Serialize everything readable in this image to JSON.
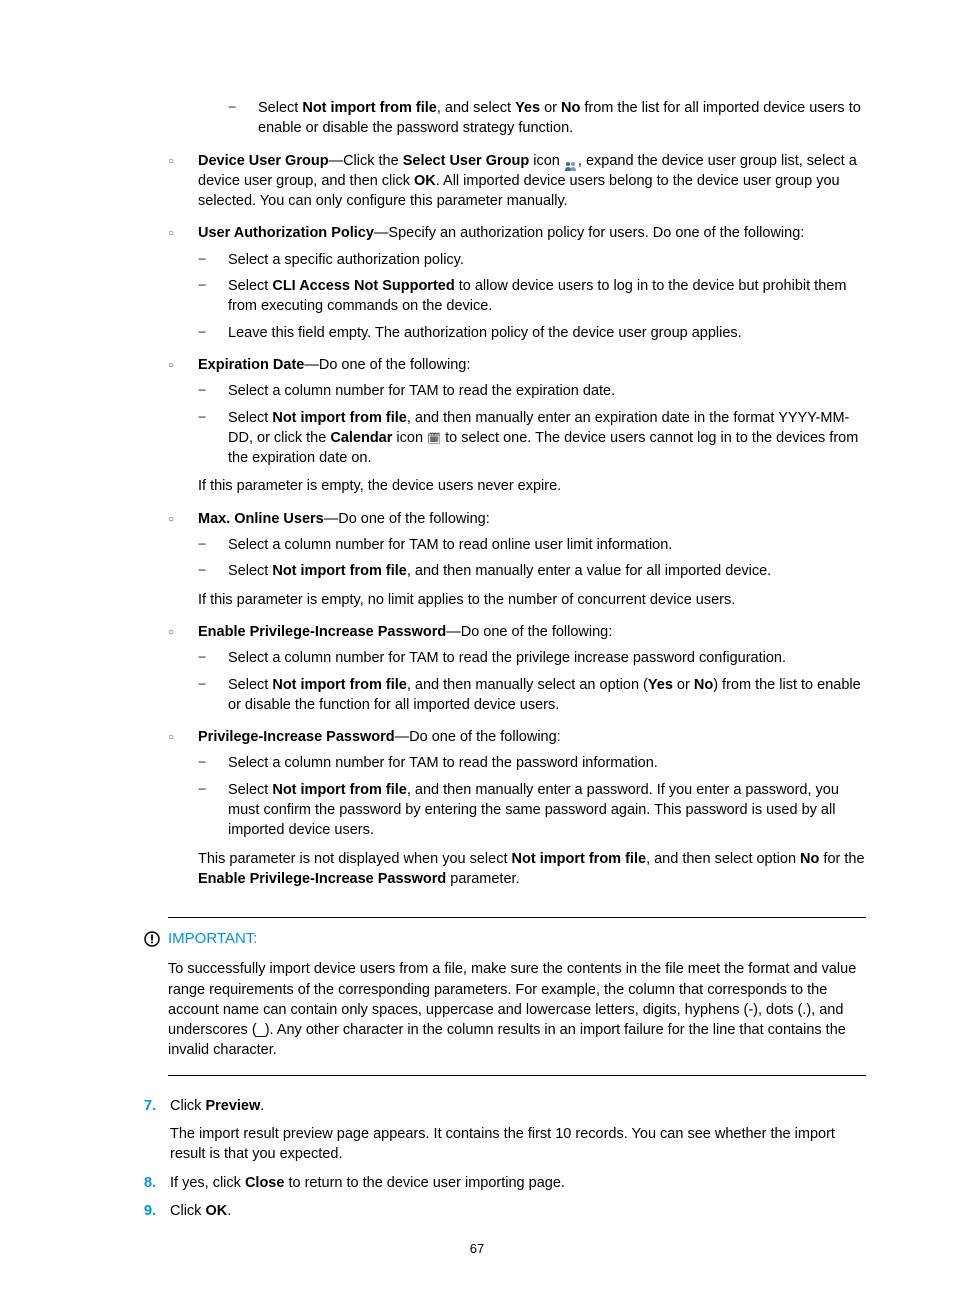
{
  "pageNumber": "67",
  "dash0a": {
    "pre": "Select ",
    "b1": "Not import from file",
    "mid": ", and select ",
    "b2": "Yes",
    "mid2": " or ",
    "b3": "No",
    "post": " from the list for all imported device users to enable or disable the password strategy function."
  },
  "item1": {
    "title": "Device User Group",
    "sep": "—Click the ",
    "b1": "Select User Group",
    "mid1": " icon ",
    "iconName": "user-group-icon",
    "mid2": ", expand the device user group list, select a device user group, and then click ",
    "b2": "OK",
    "post": ". All imported device users belong to the device user group you selected. You can only configure this parameter manually."
  },
  "item2": {
    "title": "User Authorization Policy",
    "rest": "—Specify an authorization policy for users. Do one of the following:",
    "d1": "Select a specific authorization policy.",
    "d2": {
      "pre": "Select ",
      "b1": "CLI Access Not Supported",
      "post": " to allow device users to log in to the device but prohibit them from executing commands on the device."
    },
    "d3": "Leave this field empty. The authorization policy of the device user group applies."
  },
  "item3": {
    "title": "Expiration Date",
    "rest": "—Do one of the following:",
    "d1": "Select a column number for TAM to read the expiration date.",
    "d2": {
      "pre": "Select ",
      "b1": "Not import from file",
      "mid1": ", and then manually enter an expiration date in the format YYYY-MM-DD, or click the ",
      "b2": "Calendar",
      "mid2": " icon ",
      "iconName": "calendar-icon",
      "post": " to select one. The device users cannot log in to the devices from the expiration date on."
    },
    "follow": "If this parameter is empty, the device users never expire."
  },
  "item4": {
    "title": "Max. Online Users",
    "rest": "—Do one of the following:",
    "d1": "Select a column number for TAM to read online user limit information.",
    "d2": {
      "pre": "Select ",
      "b1": "Not import from file",
      "post": ", and then manually enter a value for all imported device."
    },
    "follow": "If this parameter is empty, no limit applies to the number of concurrent device users."
  },
  "item5": {
    "title": "Enable Privilege-Increase Password",
    "rest": "—Do one of the following:",
    "d1": "Select a column number for TAM to read the privilege increase password configuration.",
    "d2": {
      "pre": "Select ",
      "b1": "Not import from file",
      "mid1": ", and then manually select an option (",
      "b2": "Yes",
      "mid2": " or ",
      "b3": "No",
      "post": ") from the list to enable or disable the function for all imported device users."
    }
  },
  "item6": {
    "title": "Privilege-Increase Password",
    "rest": "—Do one of the following:",
    "d1": "Select a column number for TAM to read the password information.",
    "d2": {
      "pre": "Select ",
      "b1": "Not import from file",
      "post": ", and then manually enter a password. If you enter a password, you must confirm the password by entering the same password again. This password is used by all imported device users."
    },
    "follow": {
      "pre": "This parameter is not displayed when you select ",
      "b1": "Not import from file",
      "mid1": ", and then select option ",
      "b2": "No",
      "mid2": " for the ",
      "b3": "Enable Privilege-Increase Password",
      "post": " parameter."
    }
  },
  "important": {
    "label": "IMPORTANT:",
    "body": "To successfully import device users from a file, make sure the contents in the file meet the format and value range requirements of the corresponding parameters. For example, the column that corresponds to the account name can contain only spaces, uppercase and lowercase letters, digits, hyphens (-), dots (.), and underscores (_). Any other character in the column results in an import failure for the line that contains the invalid character."
  },
  "step7": {
    "num": "7.",
    "pre": "Click ",
    "b1": "Preview",
    "post": ".",
    "sub": "The import result preview page appears. It contains the first 10 records. You can see whether the import result is that you expected."
  },
  "step8": {
    "num": "8.",
    "pre": "If yes, click ",
    "b1": "Close",
    "post": " to return to the device user importing page."
  },
  "step9": {
    "num": "9.",
    "pre": "Click ",
    "b1": "OK",
    "post": "."
  }
}
